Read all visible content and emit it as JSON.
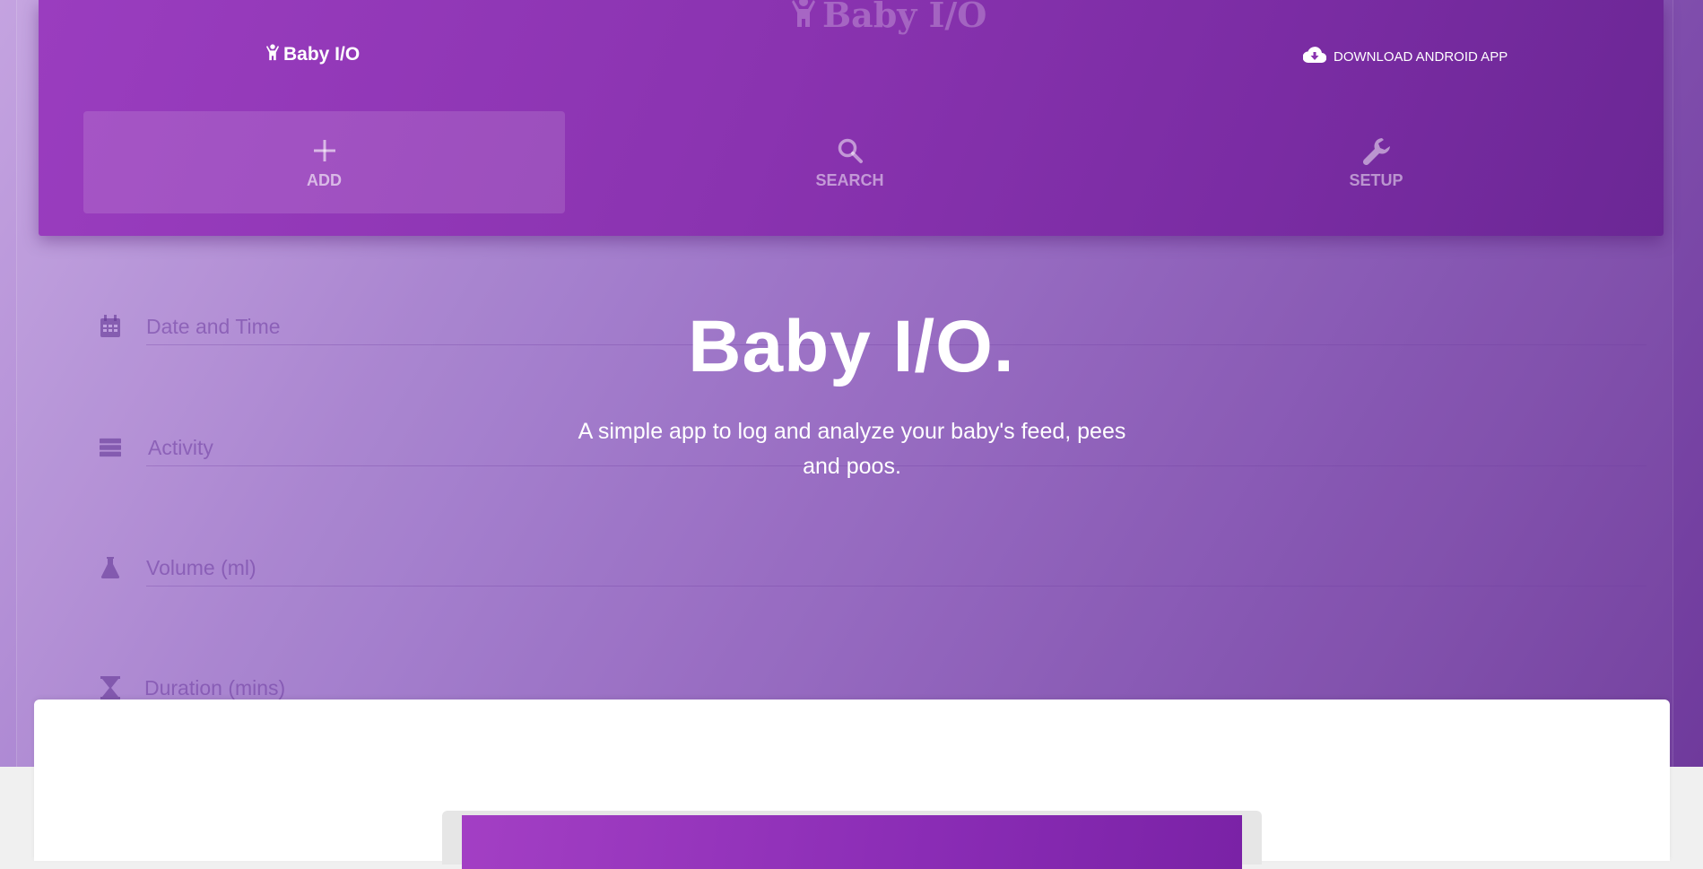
{
  "app": {
    "ghost_logo": "Baby I/O",
    "brand": "Baby I/O",
    "download_label": "DOWNLOAD ANDROID APP"
  },
  "tabs": [
    {
      "label": "ADD",
      "icon": "plus-icon",
      "active": true
    },
    {
      "label": "SEARCH",
      "icon": "search-icon",
      "active": false
    },
    {
      "label": "SETUP",
      "icon": "wrench-icon",
      "active": false
    }
  ],
  "form": {
    "fields": [
      {
        "label": "Date and Time",
        "icon": "calendar-icon"
      },
      {
        "label": "Activity",
        "icon": "list-icon"
      },
      {
        "label": "Volume (ml)",
        "icon": "flask-icon"
      },
      {
        "label": "Duration (mins)",
        "icon": "hourglass-icon"
      }
    ]
  },
  "hero": {
    "title": "Baby I/O.",
    "subtitle": "A simple app to log and analyze your baby's feed, pees and poos."
  },
  "colors": {
    "appbar": "#8a33b0",
    "hero_start": "#c4a3e0",
    "hero_end": "#6f3a9c",
    "panel": "#ffffff"
  }
}
